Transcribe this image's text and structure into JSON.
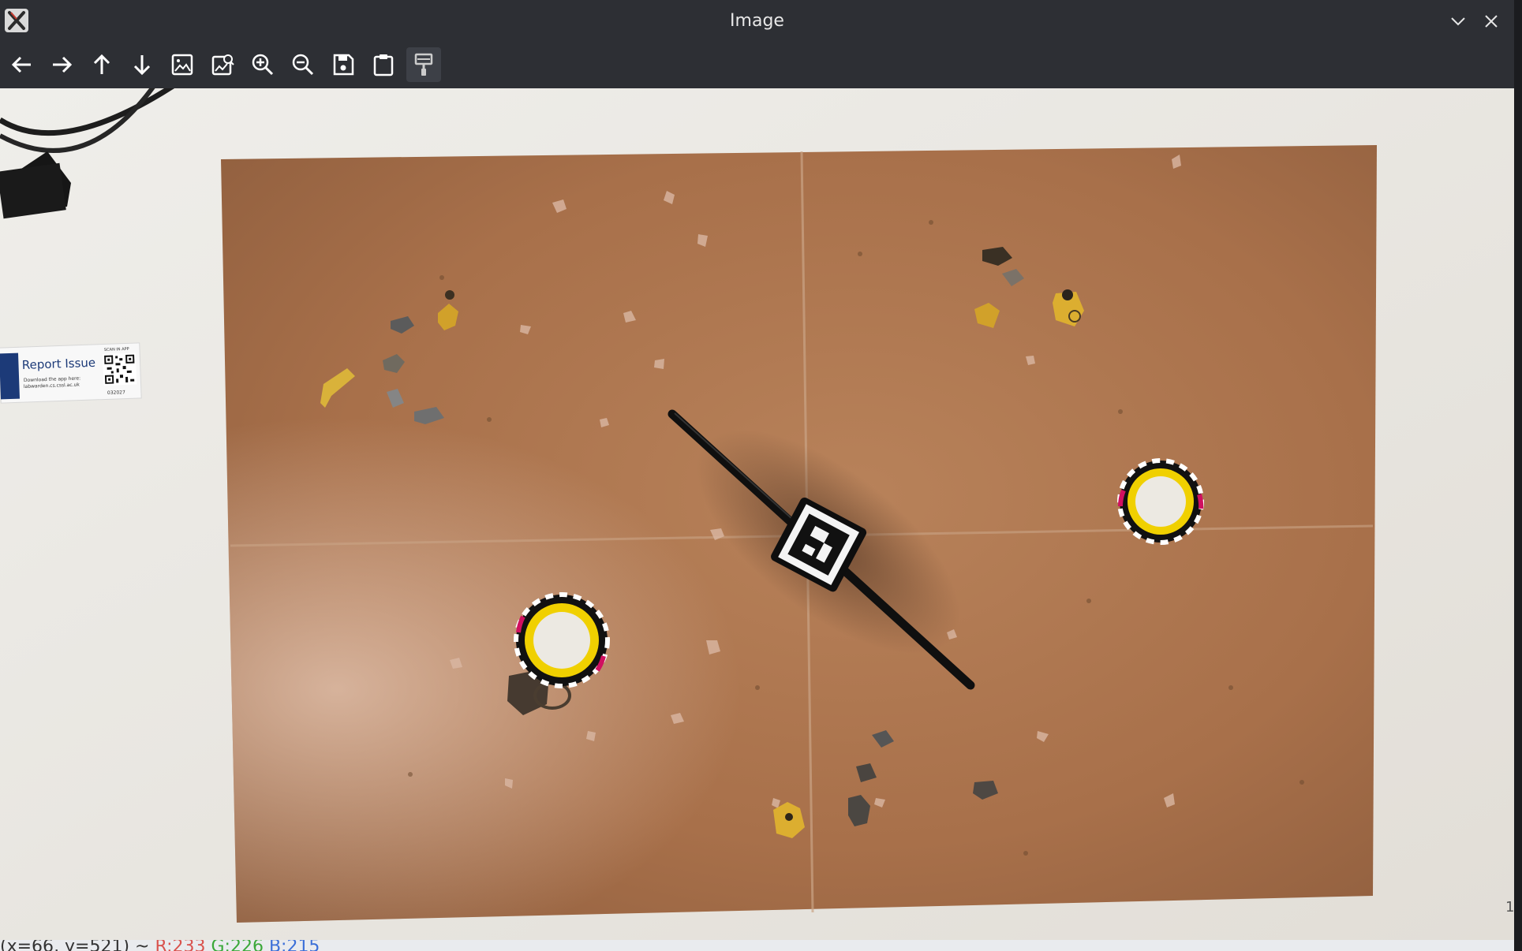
{
  "window": {
    "title": "Image",
    "app_icon": "x-app-icon",
    "controls": [
      {
        "name": "minimize",
        "icon": "chevron-down-icon"
      },
      {
        "name": "close",
        "icon": "close-icon"
      }
    ]
  },
  "toolbar": {
    "buttons": [
      {
        "name": "pan-left",
        "icon": "arrow-left-icon"
      },
      {
        "name": "pan-right",
        "icon": "arrow-right-icon"
      },
      {
        "name": "pan-up",
        "icon": "arrow-up-icon"
      },
      {
        "name": "pan-down",
        "icon": "arrow-down-icon"
      },
      {
        "name": "fit-image",
        "icon": "image-icon"
      },
      {
        "name": "original-size",
        "icon": "image-zoom-icon"
      },
      {
        "name": "zoom-in",
        "icon": "zoom-in-icon"
      },
      {
        "name": "zoom-out",
        "icon": "zoom-out-icon"
      },
      {
        "name": "save",
        "icon": "save-icon"
      },
      {
        "name": "copy-clipboard",
        "icon": "clipboard-icon"
      },
      {
        "name": "properties",
        "icon": "paint-brush-icon"
      }
    ]
  },
  "image_content": {
    "sticker": {
      "title": "Report Issue",
      "line1": "Download the app here:",
      "line2": "labwarden.cs.cssl.ac.uk",
      "header": "SCAN IN APP",
      "code": "032027"
    }
  },
  "statusbar": {
    "coord": "(x=66, y=521) ~ ",
    "r": "R:233",
    "g": "G:226",
    "b": "B:215"
  },
  "edge_mark": "1",
  "colors": {
    "titlebar": "#2d2f34",
    "table": "#ece9e2",
    "mat": "#b07a55",
    "marker_yellow": "#f0d000"
  }
}
